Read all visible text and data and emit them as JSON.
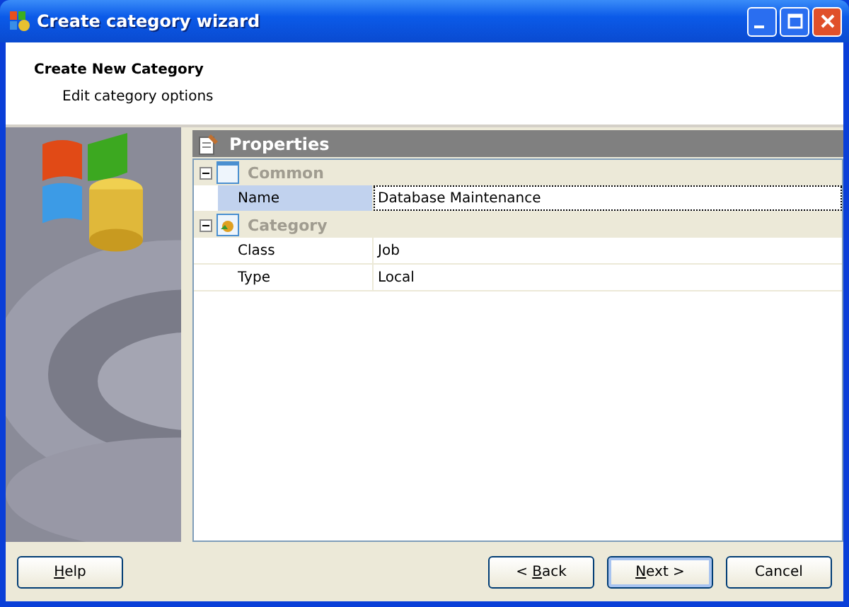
{
  "window": {
    "title": "Create category wizard"
  },
  "header": {
    "title": "Create New Category",
    "subtitle": "Edit category options"
  },
  "properties": {
    "title": "Properties",
    "groups": [
      {
        "label": "Common",
        "expanded": true,
        "kind": "common",
        "rows": [
          {
            "name": "Name",
            "value": "Database Maintenance",
            "selected": true
          }
        ]
      },
      {
        "label": "Category",
        "expanded": true,
        "kind": "category",
        "rows": [
          {
            "name": "Class",
            "value": "Job",
            "selected": false
          },
          {
            "name": "Type",
            "value": "Local",
            "selected": false
          }
        ]
      }
    ]
  },
  "footer": {
    "left_buttons": [
      {
        "mnemonic": "H",
        "after": "elp",
        "default": false
      }
    ],
    "right_buttons": [
      {
        "before": "< ",
        "mnemonic": "B",
        "after": "ack",
        "default": false
      },
      {
        "mnemonic": "N",
        "after": "ext >",
        "default": true
      },
      {
        "before": "Cancel",
        "default": false
      }
    ]
  }
}
